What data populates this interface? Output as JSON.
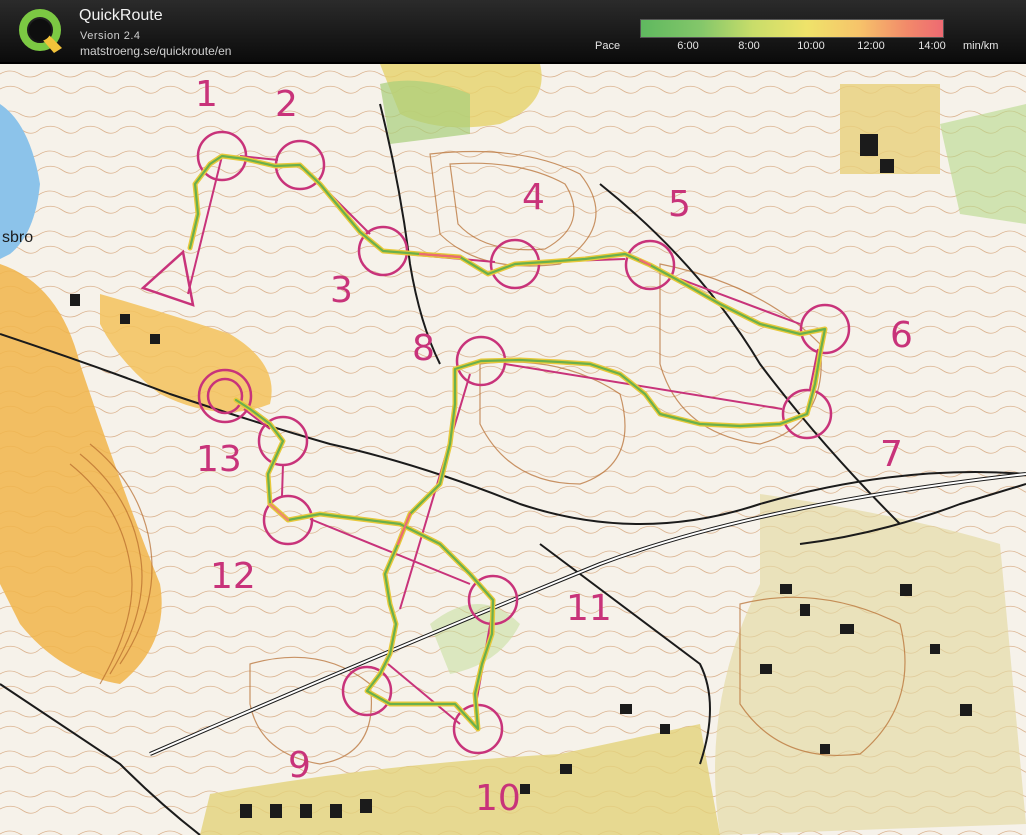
{
  "app": {
    "title": "QuickRoute",
    "version": "Version 2.4",
    "url": "matstroeng.se/quickroute/en",
    "logo_letter": "Q"
  },
  "pace_scale": {
    "label": "Pace",
    "unit": "min/km",
    "ticks": [
      "6:00",
      "8:00",
      "10:00",
      "12:00",
      "14:00"
    ],
    "colors": [
      "#5fb85f",
      "#c8dd6a",
      "#efe36a",
      "#f6c46a",
      "#ee6a72"
    ]
  },
  "map": {
    "place_label": "sbro",
    "controls": [
      "1",
      "2",
      "3",
      "4",
      "5",
      "6",
      "7",
      "8",
      "9",
      "10",
      "11",
      "12",
      "13"
    ],
    "colors": {
      "course": "#c8337a",
      "route_core": "#6ab04c",
      "route_edge": "#e8c93a",
      "forest": "#ffffff",
      "open_land": "#f2b84a",
      "water": "#7ab8e6",
      "contour": "#b56a2b",
      "building": "#1b1b1b"
    }
  }
}
